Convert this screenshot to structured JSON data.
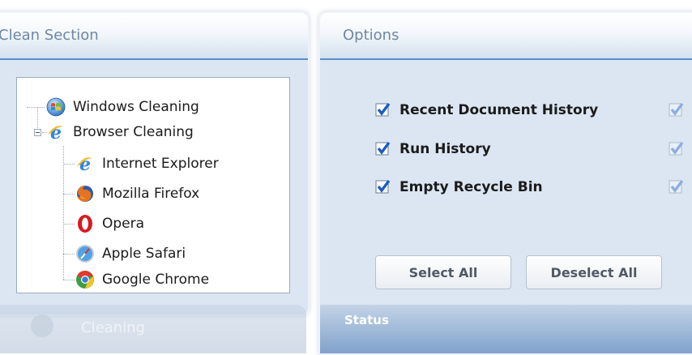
{
  "left_panel": {
    "title": "Clean Section",
    "tree": [
      {
        "label": "Windows Cleaning",
        "icon": "windows-icon",
        "level": 0
      },
      {
        "label": "Browser Cleaning",
        "icon": "ie-icon",
        "level": 0,
        "expanded": true
      },
      {
        "label": "Internet Explorer",
        "icon": "ie-icon",
        "level": 1
      },
      {
        "label": "Mozilla Firefox",
        "icon": "firefox-icon",
        "level": 1
      },
      {
        "label": "Opera",
        "icon": "opera-icon",
        "level": 1
      },
      {
        "label": "Apple Safari",
        "icon": "safari-icon",
        "level": 1
      },
      {
        "label": "Google Chrome",
        "icon": "chrome-icon",
        "level": 1
      }
    ],
    "bottom_section_label": "Cleaning"
  },
  "right_panel": {
    "title": "Options",
    "options": [
      {
        "label": "Recent Document History",
        "checked": true
      },
      {
        "label": "Run History",
        "checked": true
      },
      {
        "label": "Empty Recycle Bin",
        "checked": true
      }
    ],
    "select_all_label": "Select All",
    "deselect_all_label": "Deselect All",
    "status_label": "Status"
  },
  "colors": {
    "accent": "#5b8fcb",
    "panel_bg": "#dbe6f2",
    "check_blue": "#1d5bc4"
  }
}
